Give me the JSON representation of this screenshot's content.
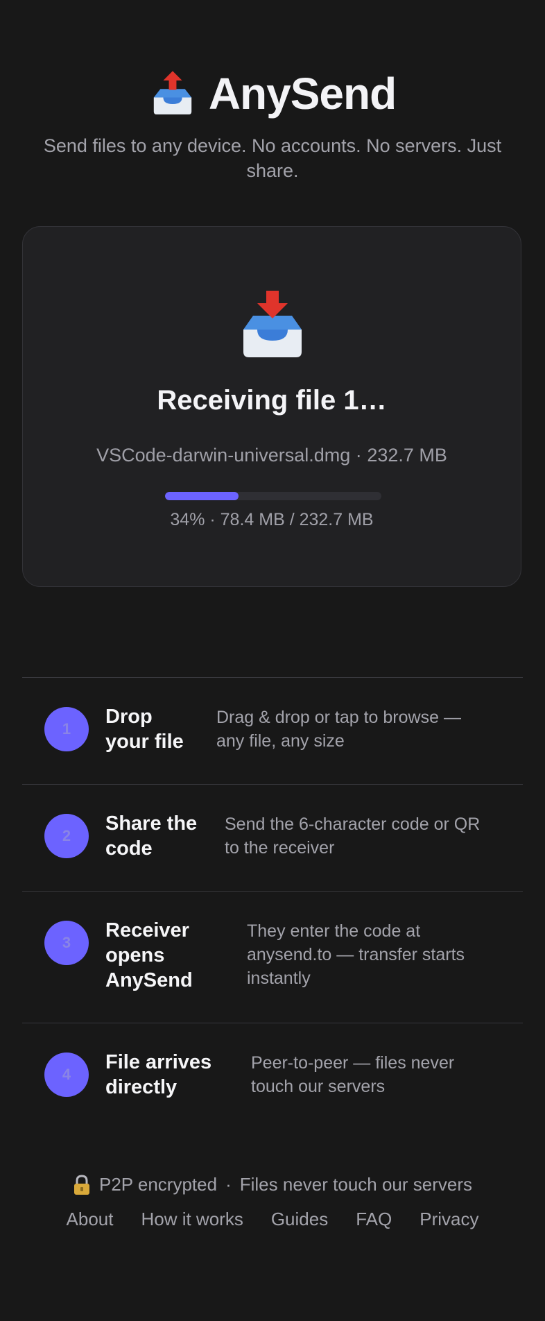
{
  "header": {
    "app_icon": "outbox-tray-icon",
    "title": "AnySend",
    "tagline": "Send files to any device. No accounts. No servers. Just share."
  },
  "transfer": {
    "icon": "inbox-tray-icon",
    "status": "Receiving file 1…",
    "file_name": "VSCode-darwin-universal.dmg",
    "file_size": "232.7 MB",
    "separator": "·",
    "progress_percent": 34,
    "progress_label": "34%",
    "received": "78.4 MB",
    "total": "232.7 MB",
    "progress_text": "34% · 78.4 MB / 232.7 MB"
  },
  "steps": [
    {
      "number": "1",
      "title_lines": [
        "Drop",
        "your file"
      ],
      "description_lines": [
        "Drag & drop or tap to browse —",
        "any file, any size"
      ]
    },
    {
      "number": "2",
      "title_lines": [
        "Share the",
        "code"
      ],
      "description_lines": [
        "Send the 6-character code or QR",
        "to the receiver"
      ]
    },
    {
      "number": "3",
      "title_lines": [
        "Receiver",
        "opens",
        "AnySend"
      ],
      "description_lines": [
        "They enter the code at",
        "anysend.to — transfer starts",
        "instantly"
      ]
    },
    {
      "number": "4",
      "title_lines": [
        "File arrives",
        "directly"
      ],
      "description_lines": [
        "Peer-to-peer — files never",
        "touch our servers"
      ]
    }
  ],
  "footer": {
    "lock_icon": "lock-icon",
    "encrypted": "P2P encrypted",
    "dot": "·",
    "privacy_note": "Files never touch our servers",
    "links": [
      "About",
      "How it works",
      "Guides",
      "FAQ",
      "Privacy"
    ]
  },
  "colors": {
    "background": "#181818",
    "card": "#212123",
    "accent": "#6c63ff",
    "text_primary": "#f4f4f7",
    "text_muted": "#a3a3ab"
  }
}
